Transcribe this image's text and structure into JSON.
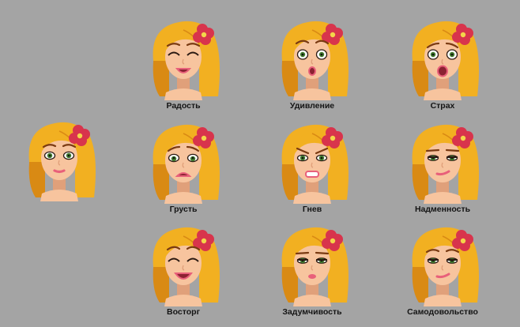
{
  "neutral": {
    "label": ""
  },
  "emotions": [
    {
      "key": "joy",
      "label": "Радость",
      "eyes": "happy",
      "brows": "up",
      "mouth": "smile"
    },
    {
      "key": "surprise",
      "label": "Удивление",
      "eyes": "wide",
      "brows": "high",
      "mouth": "o"
    },
    {
      "key": "fear",
      "label": "Страх",
      "eyes": "wide",
      "brows": "worry",
      "mouth": "scream"
    },
    {
      "key": "sadness",
      "label": "Грусть",
      "eyes": "sad",
      "brows": "worry",
      "mouth": "frown-open"
    },
    {
      "key": "anger",
      "label": "Гнев",
      "eyes": "angry",
      "brows": "angry",
      "mouth": "teeth"
    },
    {
      "key": "arrogance",
      "label": "Надменность",
      "eyes": "half",
      "brows": "flat",
      "mouth": "smirk"
    },
    {
      "key": "delight",
      "label": "Восторг",
      "eyes": "happy",
      "brows": "high",
      "mouth": "grin"
    },
    {
      "key": "pensiveness",
      "label": "Задумчивость",
      "eyes": "half",
      "brows": "flat",
      "mouth": "pout"
    },
    {
      "key": "complacency",
      "label": "Самодовольство",
      "eyes": "half",
      "brows": "up",
      "mouth": "smirk"
    }
  ],
  "colors": {
    "background": "#a4a4a4",
    "hair": "#f2b021",
    "hair_shade": "#d98a14",
    "skin": "#f7c49e",
    "skin_shade": "#e0a07a",
    "flower": "#d8344c",
    "flower_center": "#f3d54a",
    "iris": "#3f7a2e",
    "lips": "#e8607a"
  }
}
